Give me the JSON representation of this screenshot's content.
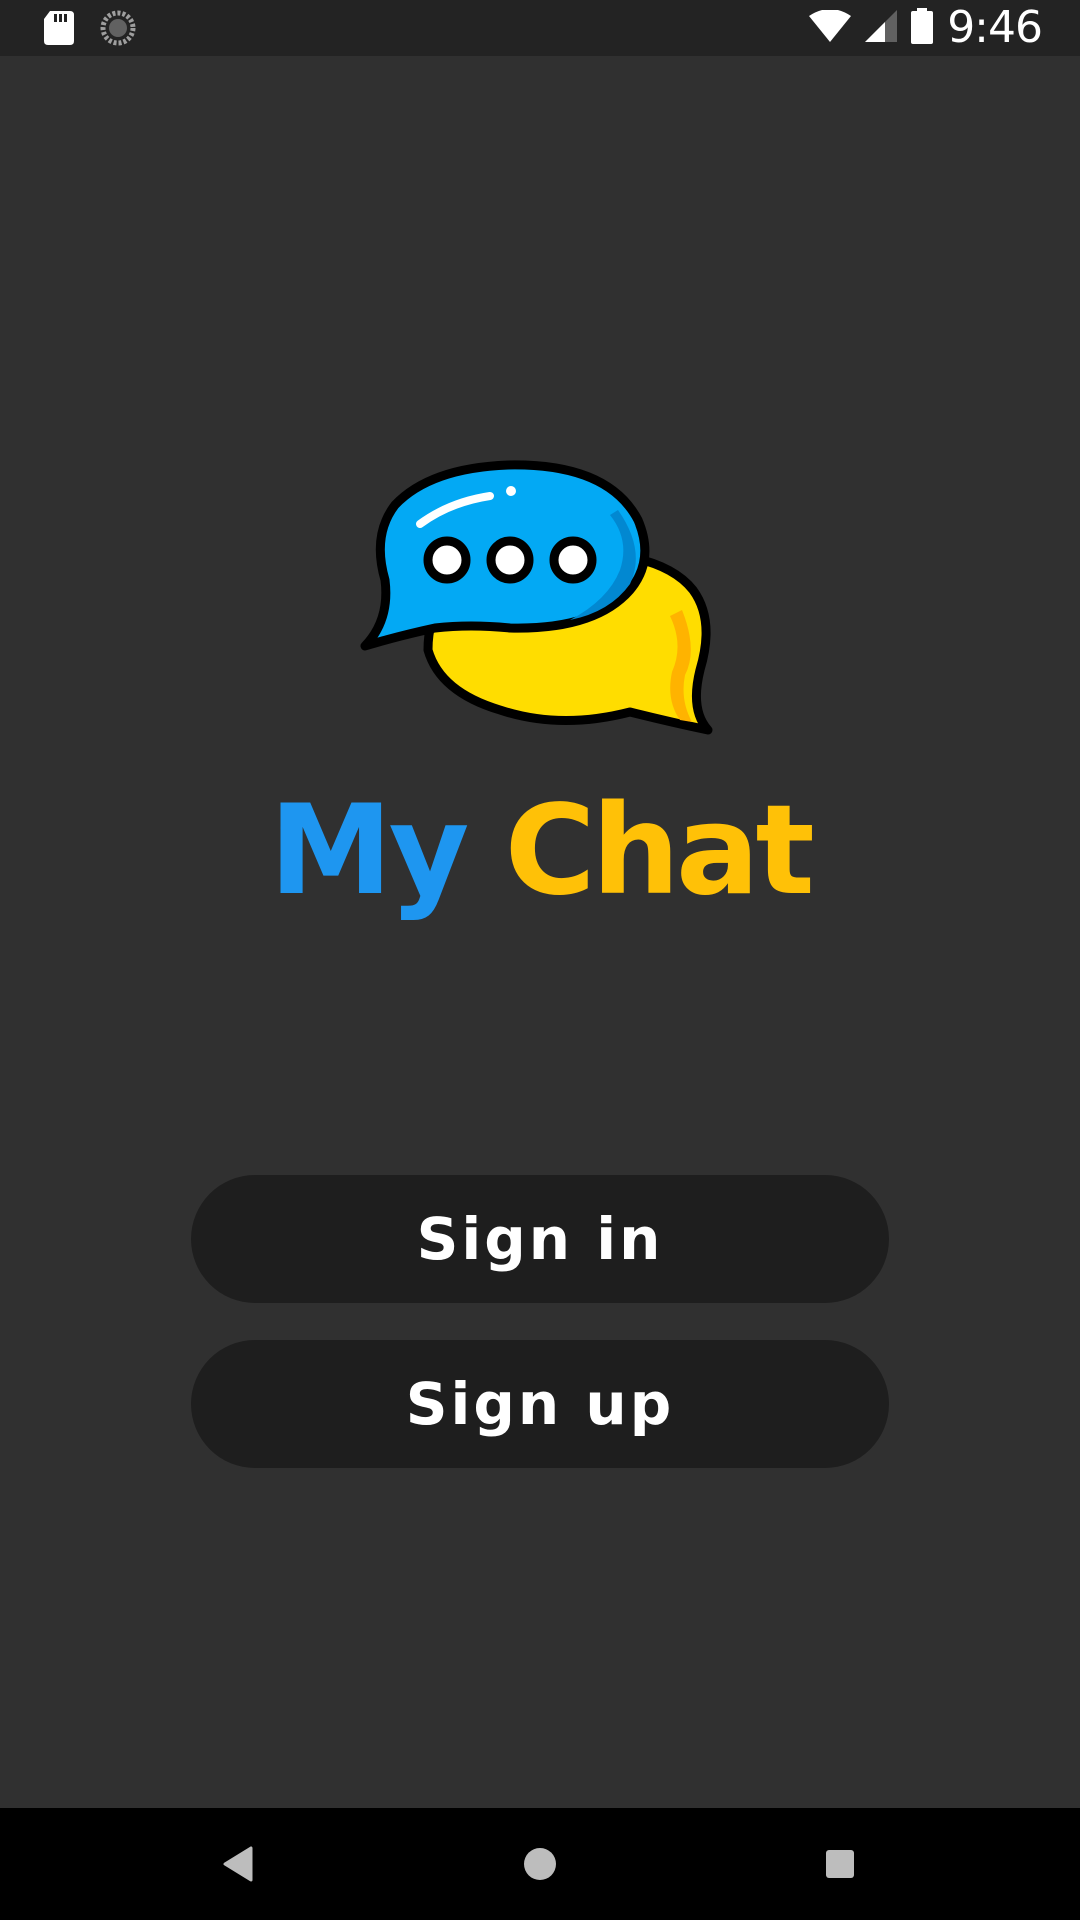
{
  "status_bar": {
    "time": "9:46",
    "icons": [
      "sd-card-icon",
      "sync-spinner-icon",
      "wifi-icon",
      "cellular-signal-icon",
      "battery-icon"
    ]
  },
  "app": {
    "title_part1": "My",
    "title_part2": "Chat",
    "logo_icon": "chat-bubbles-icon",
    "signin_label": "Sign in",
    "signup_label": "Sign up"
  },
  "nav_bar": {
    "icons": [
      "back-icon",
      "home-icon",
      "recents-icon"
    ]
  },
  "colors": {
    "background": "#303030",
    "button_bg": "#1e1e1e",
    "title_blue": "#1e96f0",
    "title_yellow": "#ffc107",
    "bubble_blue": "#03a9f4",
    "bubble_yellow": "#ffdd00"
  }
}
